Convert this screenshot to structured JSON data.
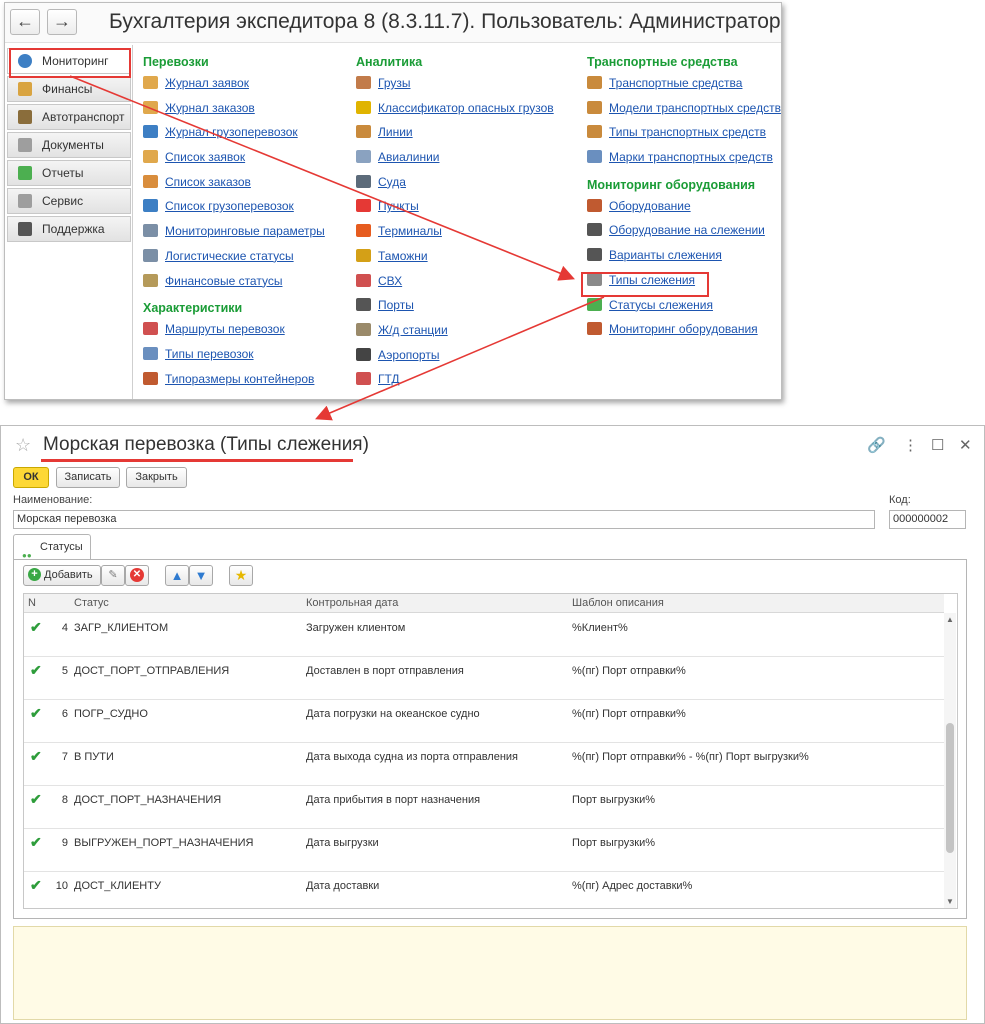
{
  "app": {
    "title": "Бухгалтерия экспедитора 8 (8.3.11.7). Пользователь: Администратор",
    "back": "←",
    "forward": "→"
  },
  "sidebar": {
    "items": [
      {
        "label": "Мониторинг",
        "icon": "globe-icon",
        "color": "#3d7fc4"
      },
      {
        "label": "Финансы",
        "icon": "coins-icon",
        "color": "#d9a441"
      },
      {
        "label": "Автотранспорт",
        "icon": "truck-icon",
        "color": "#8a6d3b"
      },
      {
        "label": "Документы",
        "icon": "document-icon",
        "color": "#9e9e9e"
      },
      {
        "label": "Отчеты",
        "icon": "chart-icon",
        "color": "#4caf50"
      },
      {
        "label": "Сервис",
        "icon": "gear-icon",
        "color": "#9e9e9e"
      },
      {
        "label": "Поддержка",
        "icon": "headset-icon",
        "color": "#555555"
      }
    ]
  },
  "columns": {
    "c1": [
      {
        "heading": "Перевозки",
        "links": [
          {
            "label": "Журнал заявок",
            "icon": "envelope-icon",
            "color": "#e0a84c"
          },
          {
            "label": "Журнал заказов",
            "icon": "envelope-icon",
            "color": "#e0a84c"
          },
          {
            "label": "Журнал грузоперевозок",
            "icon": "globe-icon",
            "color": "#3d7fc4"
          },
          {
            "label": "Список заявок",
            "icon": "envelope-icon",
            "color": "#e0a84c"
          },
          {
            "label": "Список заказов",
            "icon": "box-icon",
            "color": "#d98d3c"
          },
          {
            "label": "Список грузоперевозок",
            "icon": "ship-icon",
            "color": "#3d7fc4"
          },
          {
            "label": "Мониторинговые параметры",
            "icon": "table-icon",
            "color": "#7b8fa6"
          },
          {
            "label": "Логистические статусы",
            "icon": "table-icon",
            "color": "#7b8fa6"
          },
          {
            "label": "Финансовые статусы",
            "icon": "money-icon",
            "color": "#b59a5a"
          }
        ]
      },
      {
        "heading": "Характеристики",
        "links": [
          {
            "label": "Маршруты перевозок",
            "icon": "route-icon",
            "color": "#d05050"
          },
          {
            "label": "Типы перевозок",
            "icon": "compass-icon",
            "color": "#6a8fbf"
          },
          {
            "label": "Типоразмеры контейнеров",
            "icon": "container-icon",
            "color": "#c05a30"
          }
        ]
      }
    ],
    "c2": [
      {
        "heading": "Аналитика",
        "links": [
          {
            "label": "Грузы",
            "icon": "sofa-icon",
            "color": "#c27b4a"
          },
          {
            "label": "Классификатор опасных грузов",
            "icon": "hazard-icon",
            "color": "#e0b400"
          },
          {
            "label": "Линии",
            "icon": "wheel-icon",
            "color": "#c98a3c"
          },
          {
            "label": "Авиалинии",
            "icon": "plane-icon",
            "color": "#8aa2c0"
          },
          {
            "label": "Суда",
            "icon": "ship-icon",
            "color": "#5c6b7a"
          },
          {
            "label": "Пункты",
            "icon": "pin-icon",
            "color": "#e53935"
          },
          {
            "label": "Терминалы",
            "icon": "cone-icon",
            "color": "#e65c1f"
          },
          {
            "label": "Таможни",
            "icon": "barrier-icon",
            "color": "#d4a017"
          },
          {
            "label": "СВХ",
            "icon": "warehouse-icon",
            "color": "#d05050"
          },
          {
            "label": "Порты",
            "icon": "anchor-icon",
            "color": "#555555"
          },
          {
            "label": "Ж/д станции",
            "icon": "rail-icon",
            "color": "#9a8a6a"
          },
          {
            "label": "Аэропорты",
            "icon": "airport-icon",
            "color": "#444444"
          },
          {
            "label": "ГТД",
            "icon": "document-icon",
            "color": "#d05050"
          }
        ]
      }
    ],
    "c3": [
      {
        "heading": "Транспортные средства",
        "links": [
          {
            "label": "Транспортные средства",
            "icon": "truck-icon",
            "color": "#c98a3c"
          },
          {
            "label": "Модели транспортных средств",
            "icon": "truck-icon",
            "color": "#c98a3c"
          },
          {
            "label": "Типы транспортных средств",
            "icon": "truck-icon",
            "color": "#c98a3c"
          },
          {
            "label": "Марки транспортных средств",
            "icon": "car-icon",
            "color": "#6a8fbf"
          }
        ]
      },
      {
        "heading": "Мониторинг оборудования",
        "links": [
          {
            "label": "Оборудование",
            "icon": "tracker-icon",
            "color": "#c05a30"
          },
          {
            "label": "Оборудование на слежении",
            "icon": "binoculars-icon",
            "color": "#555555"
          },
          {
            "label": "Варианты слежения",
            "icon": "binoculars-icon",
            "color": "#555555"
          },
          {
            "label": "Типы слежения",
            "icon": "device-icon",
            "color": "#8a8a8a"
          },
          {
            "label": "Статусы слежения",
            "icon": "flag-icon",
            "color": "#4caf50"
          },
          {
            "label": "Мониторинг оборудования",
            "icon": "report-icon",
            "color": "#c05a30"
          }
        ]
      }
    ]
  },
  "form": {
    "title": "Морская перевозка (Типы слежения)",
    "buttons": {
      "ok": "ОК",
      "save": "Записать",
      "close": "Закрыть"
    },
    "name_label": "Наименование:",
    "name_value": "Морская перевозка",
    "code_label": "Код:",
    "code_value": "000000002",
    "tab": "Статусы",
    "toolbar": {
      "add": "Добавить"
    },
    "columns": {
      "n": "N",
      "status": "Статус",
      "date": "Контрольная дата",
      "template": "Шаблон описания"
    },
    "rows": [
      {
        "n": "4",
        "status": "ЗАГР_КЛИЕНТОМ",
        "date": "Загружен клиентом",
        "template": "%Клиент%"
      },
      {
        "n": "5",
        "status": "ДОСТ_ПОРТ_ОТПРАВЛЕНИЯ",
        "date": "Доставлен в порт отправления",
        "template": "%(пг) Порт отправки%"
      },
      {
        "n": "6",
        "status": "ПОГР_СУДНО",
        "date": "Дата погрузки на океанское судно",
        "template": "%(пг) Порт отправки%"
      },
      {
        "n": "7",
        "status": "В ПУТИ",
        "date": "Дата выхода судна из порта отправления",
        "template": "%(пг) Порт отправки% - %(пг) Порт выгрузки%"
      },
      {
        "n": "8",
        "status": "ДОСТ_ПОРТ_НАЗНАЧЕНИЯ",
        "date": "Дата прибытия в порт назначения",
        "template": "Порт выгрузки%"
      },
      {
        "n": "9",
        "status": "ВЫГРУЖЕН_ПОРТ_НАЗНАЧЕНИЯ",
        "date": "Дата выгрузки",
        "template": "Порт выгрузки%"
      },
      {
        "n": "10",
        "status": "ДОСТ_КЛИЕНТУ",
        "date": "Дата доставки",
        "template": "%(пг) Адрес доставки%"
      }
    ]
  },
  "colors": {
    "accent_green": "#1a9c36",
    "link": "#1d55b0",
    "highlight": "#e53935",
    "ok_button": "#fdd835",
    "note_bg": "#fffbe6"
  }
}
